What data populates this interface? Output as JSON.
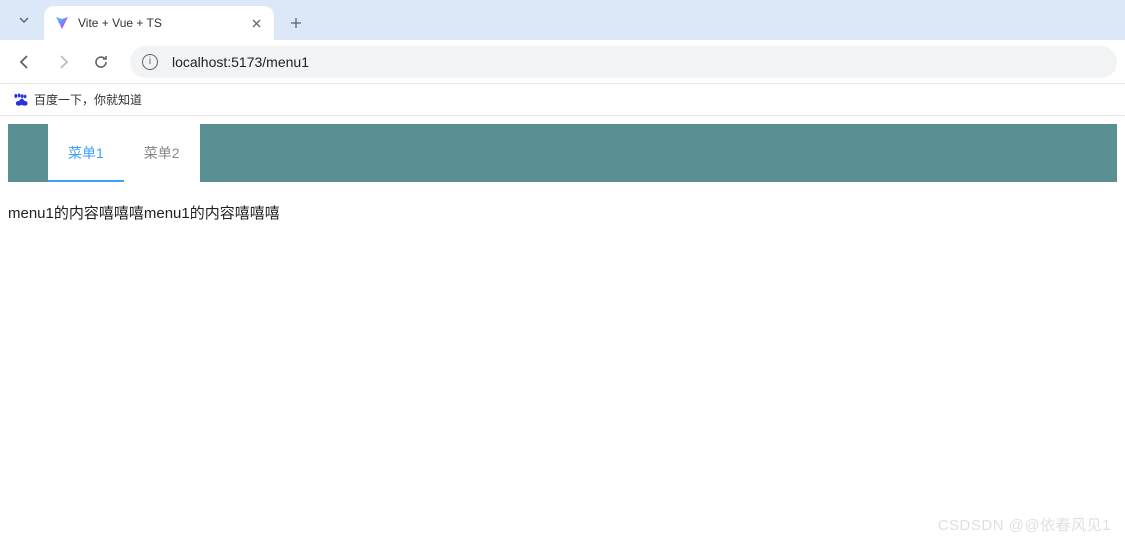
{
  "browser": {
    "tab_title": "Vite + Vue + TS",
    "url": "localhost:5173/menu1"
  },
  "bookmarks": {
    "baidu_label": "百度一下，你就知道"
  },
  "menu": {
    "tabs": [
      {
        "label": "菜单1",
        "active": true
      },
      {
        "label": "菜单2",
        "active": false
      }
    ]
  },
  "content": {
    "text": "menu1的内容嘻嘻嘻menu1的内容嘻嘻嘻"
  },
  "watermark": "CSDSDN @@依春风见1"
}
